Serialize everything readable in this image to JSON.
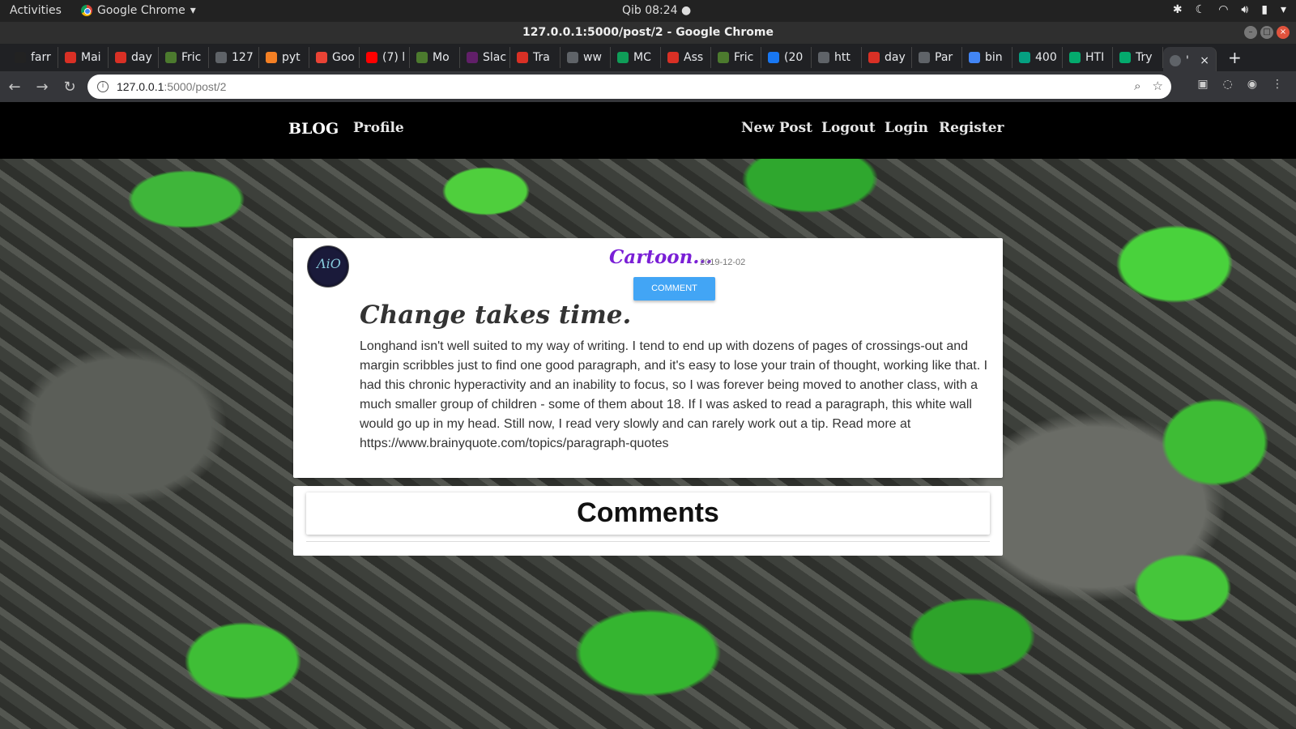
{
  "os": {
    "activities": "Activities",
    "app_name": "Google Chrome",
    "clock": "Qib 08:24"
  },
  "window": {
    "title": "127.0.0.1:5000/post/2 - Google Chrome"
  },
  "tabs": [
    {
      "label": "farr",
      "color": "#222222"
    },
    {
      "label": "Mai",
      "color": "#d93025"
    },
    {
      "label": "day",
      "color": "#d93025"
    },
    {
      "label": "Fric",
      "color": "#4c7a2e"
    },
    {
      "label": "127",
      "color": "#5f6368"
    },
    {
      "label": "pyt",
      "color": "#f48024"
    },
    {
      "label": "Goo",
      "color": "#ea4335"
    },
    {
      "label": "(7) l",
      "color": "#ff0000"
    },
    {
      "label": "Mo",
      "color": "#4c7a2e"
    },
    {
      "label": "Slac",
      "color": "#611f69"
    },
    {
      "label": "Tra",
      "color": "#d93025"
    },
    {
      "label": "ww",
      "color": "#5f6368"
    },
    {
      "label": "MC",
      "color": "#0f9d58"
    },
    {
      "label": "Ass",
      "color": "#d93025"
    },
    {
      "label": "Fric",
      "color": "#4c7a2e"
    },
    {
      "label": "(20",
      "color": "#1877f2"
    },
    {
      "label": "htt",
      "color": "#5f6368"
    },
    {
      "label": "day",
      "color": "#d93025"
    },
    {
      "label": "Par",
      "color": "#5f6368"
    },
    {
      "label": "bin",
      "color": "#4285f4"
    },
    {
      "label": "400",
      "color": "#05a081"
    },
    {
      "label": "HTI",
      "color": "#04aa6d"
    },
    {
      "label": "Try",
      "color": "#04aa6d"
    }
  ],
  "active_tab": {
    "label": "'",
    "close": "×"
  },
  "address_bar": {
    "host": "127.0.0.1",
    "path": ":5000/post/2"
  },
  "navbar": {
    "brand": "BLOG",
    "profile": "Profile",
    "new_post": "New Post",
    "logout": "Logout",
    "login": "Login",
    "register": "Register"
  },
  "post": {
    "author": "Cartoon...",
    "date": "2019-12-02",
    "comment_button": "COMMENT",
    "title": "Change takes time.",
    "body": "Longhand isn't well suited to my way of writing. I tend to end up with dozens of pages of crossings-out and margin scribbles just to find one good paragraph, and it's easy to lose your train of thought, working like that. I had this chronic hyperactivity and an inability to focus, so I was forever being moved to another class, with a much smaller group of children - some of them about 18. If I was asked to read a paragraph, this white wall would go up in my head. Still now, I read very slowly and can rarely work out a tip. Read more at https://www.brainyquote.com/topics/paragraph-quotes"
  },
  "comments": {
    "heading": "Comments"
  },
  "colors": {
    "author": "#7a1fd6",
    "comment_button": "#42a5f5",
    "navbar": "#000000"
  }
}
